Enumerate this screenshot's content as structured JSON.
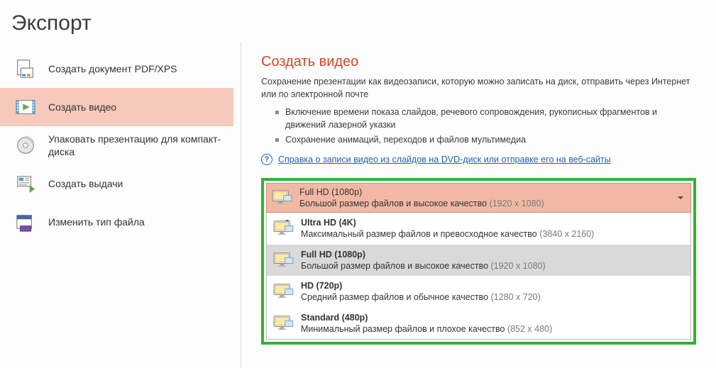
{
  "page_title": "Экспорт",
  "sidebar": {
    "items": [
      {
        "label": "Создать документ PDF/XPS"
      },
      {
        "label": "Создать видео"
      },
      {
        "label": "Упаковать презентацию для компакт-диска"
      },
      {
        "label": "Создать выдачи"
      },
      {
        "label": "Изменить тип файла"
      }
    ]
  },
  "main": {
    "heading": "Создать видео",
    "intro": "Сохранение презентации как видеозаписи, которую можно записать на диск, отправить через Интернет или по электронной почте",
    "bullets": [
      "Включение времени показа слайдов, речевого сопровождения, рукописных фрагментов и движений лазерной указки",
      "Сохранение анимаций, переходов и файлов мультимедиа"
    ],
    "help_link": "Справка о записи видео из слайдов на DVD-диск или отправке его на веб-сайты"
  },
  "quality": {
    "selected": {
      "title": "Full HD (1080p)",
      "desc": "Большой размер файлов и высокое качество ",
      "dim": "(1920 x 1080)"
    },
    "options": [
      {
        "title": "Ultra HD (4K)",
        "desc": "Максимальный размер файлов и превосходное качество ",
        "dim": "(3840 x 2160)",
        "highlight": false,
        "star": true
      },
      {
        "title": "Full HD (1080p)",
        "desc": "Большой размер файлов и высокое качество ",
        "dim": "(1920 x 1080)",
        "highlight": true,
        "star": false
      },
      {
        "title": "HD (720p)",
        "desc": "Средний размер файлов и обычное качество ",
        "dim": "(1280 x 720)",
        "highlight": false,
        "star": false
      },
      {
        "title": "Standard (480p)",
        "desc": "Минимальный размер файлов и плохое качество ",
        "dim": "(852 x 480)",
        "highlight": false,
        "star": false
      }
    ]
  }
}
